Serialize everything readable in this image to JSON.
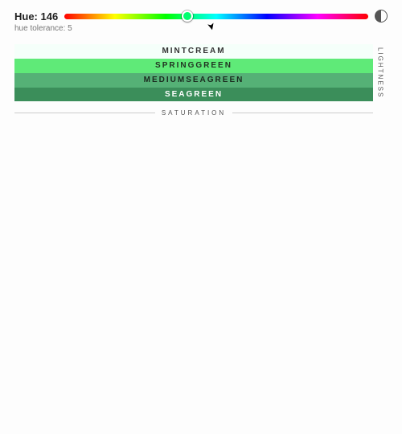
{
  "hue": {
    "label_prefix": "Hue:",
    "value": 146,
    "tolerance_label": "hue tolerance: 5",
    "slider_percent": 40.5
  },
  "swatches": [
    {
      "name": "MINTCREAM",
      "bg": "#f5fffa",
      "fg": "#333333"
    },
    {
      "name": "SPRINGGREEN",
      "bg": "#5fea78",
      "fg": "#223322"
    },
    {
      "name": "MEDIUMSEAGREEN",
      "bg": "#55b176",
      "fg": "#1b2b1f"
    },
    {
      "name": "SEAGREEN",
      "bg": "#3b8e5a",
      "fg": "#ffffff"
    }
  ],
  "axes": {
    "lightness": "LIGHTNESS",
    "saturation": "SATURATION"
  }
}
